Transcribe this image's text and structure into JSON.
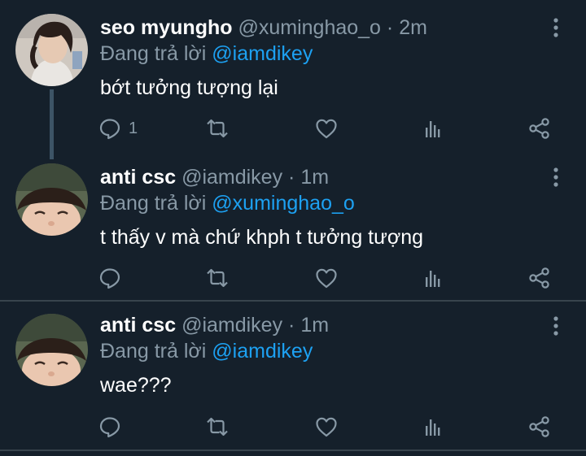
{
  "colors": {
    "background": "#15202b",
    "text_primary": "#ffffff",
    "text_secondary": "#8899a6",
    "link": "#1da1f2",
    "divider": "#38444d"
  },
  "tweets": [
    {
      "display_name": "seo myungho",
      "handle": "@xuminghao_o",
      "separator": "·",
      "time": "2m",
      "reply_prefix": "Đang trả lời",
      "reply_to": "@iamdikey",
      "text": "bớt tưởng tượng lại",
      "reply_count": "1",
      "icons": [
        "reply-icon",
        "retweet-icon",
        "like-icon",
        "analytics-icon",
        "share-icon",
        "more-icon"
      ]
    },
    {
      "display_name": "anti csc",
      "handle": "@iamdikey",
      "separator": "·",
      "time": "1m",
      "reply_prefix": "Đang trả lời",
      "reply_to": "@xuminghao_o",
      "text": "t thấy v mà chứ khph t tưởng tượng",
      "icons": [
        "reply-icon",
        "retweet-icon",
        "like-icon",
        "analytics-icon",
        "share-icon",
        "more-icon"
      ]
    },
    {
      "display_name": "anti csc",
      "handle": "@iamdikey",
      "separator": "·",
      "time": "1m",
      "reply_prefix": "Đang trả lời",
      "reply_to": "@iamdikey",
      "text": "wae???",
      "icons": [
        "reply-icon",
        "retweet-icon",
        "like-icon",
        "analytics-icon",
        "share-icon",
        "more-icon"
      ]
    }
  ]
}
